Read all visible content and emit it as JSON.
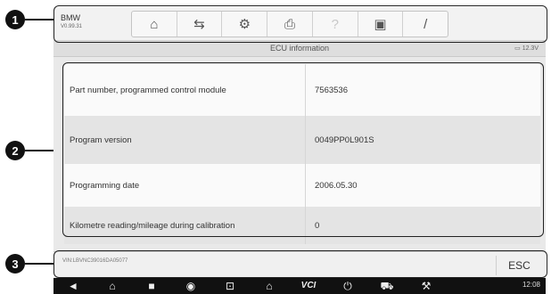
{
  "markers": [
    "1",
    "2",
    "3"
  ],
  "toolbar": {
    "brand": "BMW",
    "version": "V0.99.31",
    "buttons": [
      {
        "name": "home-button",
        "icon": "home-icon",
        "glyph": "⌂",
        "enabled": true
      },
      {
        "name": "vehicle-swap-button",
        "icon": "car-swap-icon",
        "glyph": "⇆",
        "enabled": true
      },
      {
        "name": "settings-button",
        "icon": "gear-icon",
        "glyph": "⚙",
        "enabled": true
      },
      {
        "name": "print-button",
        "icon": "printer-icon",
        "glyph": "⎙",
        "enabled": true
      },
      {
        "name": "help-button",
        "icon": "help-icon",
        "glyph": "?",
        "enabled": false
      },
      {
        "name": "save-button",
        "icon": "save-icon",
        "glyph": "▣",
        "enabled": true
      },
      {
        "name": "edit-button",
        "icon": "pen-icon",
        "glyph": "/",
        "enabled": true
      }
    ]
  },
  "titlebar": {
    "title": "ECU information",
    "battery": "12.3V"
  },
  "info_rows": [
    {
      "label": "Part number, programmed control module",
      "value": "7563536"
    },
    {
      "label": "Program version",
      "value": "0049PP0L901S"
    },
    {
      "label": "Programming date",
      "value": "2006.05.30"
    },
    {
      "label": "Kilometre reading/mileage during calibration",
      "value": "0"
    }
  ],
  "footer": {
    "vin": "VIN:LBVNC39016DA05077",
    "esc_label": "ESC"
  },
  "navbar": {
    "buttons": [
      {
        "name": "back-button",
        "icon": "back-icon",
        "glyph": "◄"
      },
      {
        "name": "home-nav-button",
        "icon": "home-icon",
        "glyph": "⌂"
      },
      {
        "name": "recents-button",
        "icon": "recents-icon",
        "glyph": "■"
      },
      {
        "name": "browser-button",
        "icon": "browser-icon",
        "glyph": "◉"
      },
      {
        "name": "screenshot-button",
        "icon": "screenshot-icon",
        "glyph": "⊡"
      },
      {
        "name": "maxisys-button",
        "icon": "maxisys-home-icon",
        "glyph": "⌂"
      },
      {
        "name": "vci-button",
        "icon": "vci-icon",
        "glyph": "VCI"
      },
      {
        "name": "power-button",
        "icon": "power-icon",
        "glyph": "⏻"
      },
      {
        "name": "car-button",
        "icon": "car-icon",
        "glyph": "⛟"
      },
      {
        "name": "shop-button",
        "icon": "shop-icon",
        "glyph": "⚒"
      }
    ],
    "clock": "12:08"
  }
}
